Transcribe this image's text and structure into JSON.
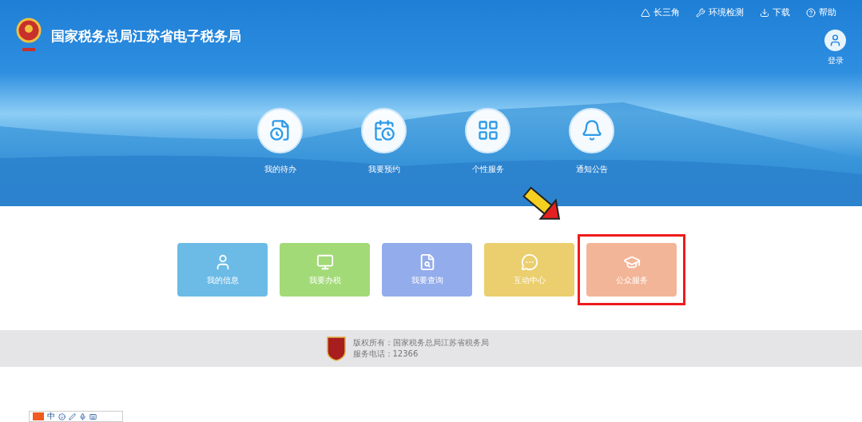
{
  "header": {
    "title": "国家税务总局江苏省电子税务局",
    "links": [
      {
        "kind": "triangle",
        "label": "长三角"
      },
      {
        "kind": "wrench",
        "label": "环境检测"
      },
      {
        "kind": "download",
        "label": "下载"
      },
      {
        "kind": "help",
        "label": "帮助"
      }
    ],
    "login": "登录"
  },
  "quick_items": [
    {
      "kind": "todo",
      "label": "我的待办"
    },
    {
      "kind": "calendar",
      "label": "我要预约"
    },
    {
      "kind": "grid",
      "label": "个性服务"
    },
    {
      "kind": "bell",
      "label": "通知公告"
    }
  ],
  "tiles": [
    {
      "kind": "user",
      "label": "我的信息",
      "color": "#6bbbe6",
      "highlighted": false
    },
    {
      "kind": "monitor",
      "label": "我要办税",
      "color": "#a3da78",
      "highlighted": false
    },
    {
      "kind": "search",
      "label": "我要查询",
      "color": "#93aceb",
      "highlighted": false
    },
    {
      "kind": "chat",
      "label": "互动中心",
      "color": "#ebcf6e",
      "highlighted": false
    },
    {
      "kind": "graduate",
      "label": "公众服务",
      "color": "#f3b597",
      "highlighted": true
    }
  ],
  "footer": {
    "lines": [
      "版权所有：国家税务总局江苏省税务局",
      "服务电话：12366"
    ]
  },
  "ime_toolbar": {
    "mode": "中"
  }
}
